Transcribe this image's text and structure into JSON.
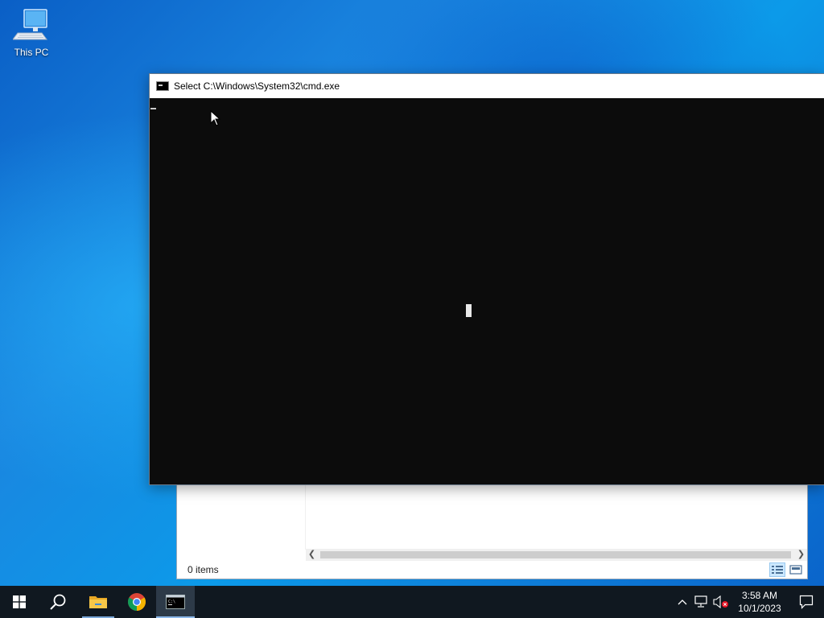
{
  "desktop": {
    "icons": [
      {
        "label": "This PC",
        "icon": "this-pc-icon"
      }
    ]
  },
  "cmd_window": {
    "title": "Select C:\\Windows\\System32\\cmd.exe",
    "icon": "cmd-icon"
  },
  "explorer_window": {
    "status_text": "0 items",
    "view_buttons": [
      "details-view-icon",
      "large-icons-view-icon"
    ]
  },
  "taskbar": {
    "apps": [
      {
        "name": "start",
        "icon": "windows-logo-icon"
      },
      {
        "name": "search",
        "icon": "search-icon"
      },
      {
        "name": "file-explorer",
        "icon": "folder-icon"
      },
      {
        "name": "chrome",
        "icon": "chrome-icon"
      },
      {
        "name": "command-prompt",
        "icon": "cmd-icon"
      }
    ],
    "tray": {
      "icons": [
        "chevron-up-icon",
        "network-icon",
        "volume-muted-icon"
      ],
      "time": "3:58 AM",
      "date": "10/1/2023",
      "notification_icon": "action-center-icon"
    }
  },
  "colors": {
    "taskbar_bg": "#101820",
    "console_bg": "#0c0c0c",
    "titlebar_bg": "#ffffff"
  }
}
